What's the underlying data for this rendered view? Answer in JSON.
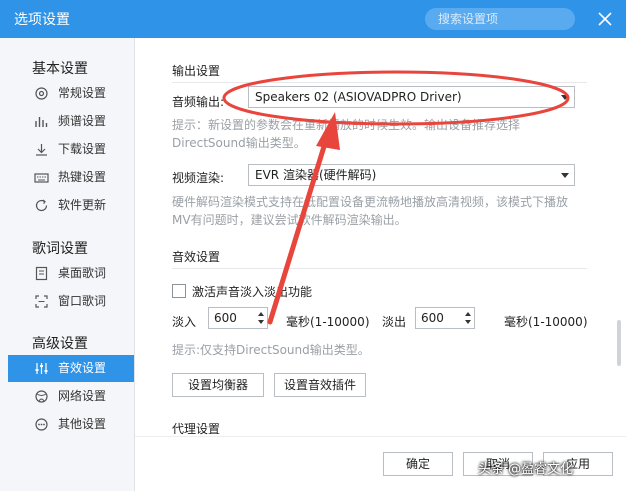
{
  "window": {
    "title": "选项设置",
    "search_placeholder": "搜索设置项"
  },
  "sidebar": {
    "groups": [
      {
        "title": "基本设置",
        "items": [
          {
            "label": "常规设置",
            "icon": "gear-icon"
          },
          {
            "label": "频谱设置",
            "icon": "bars-icon"
          },
          {
            "label": "下载设置",
            "icon": "download-icon"
          },
          {
            "label": "热键设置",
            "icon": "keyboard-icon"
          },
          {
            "label": "软件更新",
            "icon": "refresh-icon"
          }
        ]
      },
      {
        "title": "歌词设置",
        "items": [
          {
            "label": "桌面歌词",
            "icon": "desktop-lyrics-icon"
          },
          {
            "label": "窗口歌词",
            "icon": "window-lyrics-icon"
          }
        ]
      },
      {
        "title": "高级设置",
        "items": [
          {
            "label": "音效设置",
            "icon": "equalizer-icon",
            "active": true
          },
          {
            "label": "网络设置",
            "icon": "globe-icon"
          },
          {
            "label": "其他设置",
            "icon": "more-icon"
          }
        ]
      }
    ]
  },
  "output": {
    "section_title": "输出设置",
    "audio_label": "音频输出:",
    "audio_value": "Speakers 02 (ASIOVADPRO Driver)",
    "audio_hint_1": "提示：新设置的参数会在重新播放的时候生效。输出设备推荐选择",
    "audio_hint_2": "DirectSound输出类型。",
    "video_label": "视频渲染:",
    "video_value": "EVR 渲染器(硬件解码)",
    "video_hint_1": "硬件解码渲染模式支持在低配置设备更流畅地播放高清视频，该模式下播放",
    "video_hint_2": "MV有问题时，建议尝试软件解码渲染输出。"
  },
  "effects": {
    "section_title": "音效设置",
    "fade_checkbox_label": "激活声音淡入淡出功能",
    "fade_in_label": "淡入",
    "fade_in_value": "600",
    "fade_in_unit": "毫秒(1-10000)",
    "fade_out_label": "淡出",
    "fade_out_value": "600",
    "fade_out_unit": "毫秒(1-10000)",
    "hint": "提示:仅支持DirectSound输出类型。",
    "equalizer_button": "设置均衡器",
    "plugin_button": "设置音效插件"
  },
  "proxy": {
    "section_title": "代理设置"
  },
  "footer": {
    "ok_button": "确定",
    "cancel_button": "取消",
    "apply_button": "应用"
  },
  "watermark": "头条 @盈睿文化",
  "colors": {
    "accent": "#2f93e8",
    "annotation_red": "#e8453c"
  }
}
